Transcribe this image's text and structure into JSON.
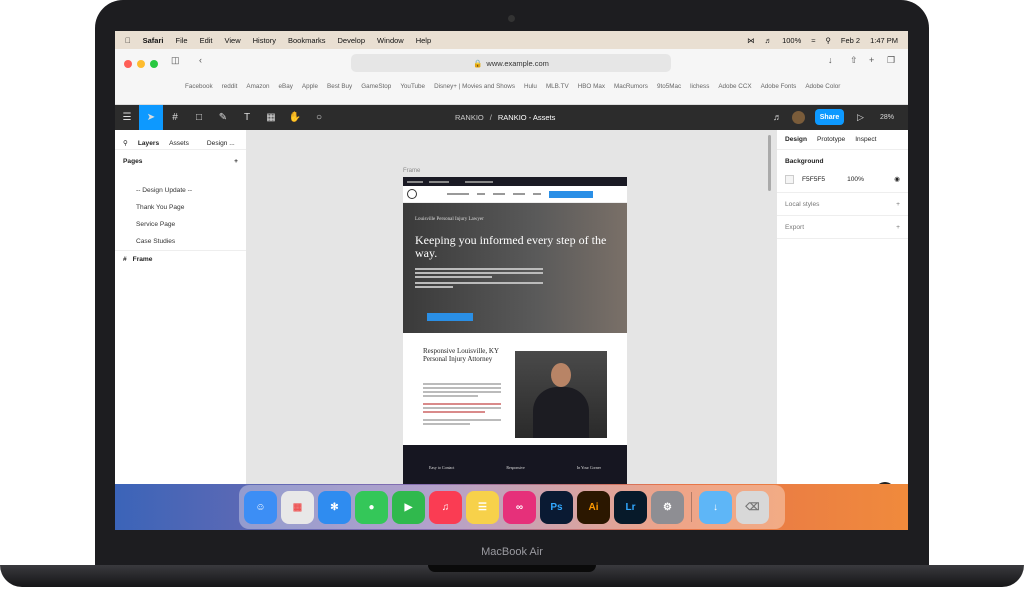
{
  "menubar": {
    "app": "Safari",
    "items": [
      "File",
      "Edit",
      "View",
      "History",
      "Bookmarks",
      "Develop",
      "Window",
      "Help"
    ],
    "battery": "100%",
    "date": "Feb 2",
    "time": "1:47 PM"
  },
  "safari": {
    "url": "www.example.com",
    "favorites": [
      "Facebook",
      "reddit",
      "Amazon",
      "eBay",
      "Apple",
      "Best Buy",
      "GameStop",
      "YouTube",
      "Disney+ | Movies and Shows",
      "Hulu",
      "MLB.TV",
      "HBO Max",
      "MacRumors",
      "9to5Mac",
      "lichess",
      "Adobe CCX",
      "Adobe Fonts",
      "Adobe Color"
    ]
  },
  "figma": {
    "project": "RANKIO",
    "file": "RANKIO - Assets",
    "share": "Share",
    "zoom": "28%"
  },
  "left_panel": {
    "tab_layers": "Layers",
    "tab_assets": "Assets",
    "tab_design": "Design ...",
    "pages_title": "Pages",
    "pages": [
      "-- Design Update --",
      "Thank You Page",
      "Service Page",
      "Case Studies"
    ],
    "layer_frame": "Frame"
  },
  "canvas": {
    "frame_label": "Frame"
  },
  "site": {
    "kicker": "Louisville Personal Injury Lawyer",
    "headline": "Keeping you informed every step of the way.",
    "about_title": "Responsive Louisville, KY Personal Injury Attorney",
    "footer_cols": [
      "Easy to Contact",
      "Responsive",
      "In Your Corner"
    ]
  },
  "right_panel": {
    "tab_design": "Design",
    "tab_prototype": "Prototype",
    "tab_inspect": "Inspect",
    "background_title": "Background",
    "bg_hex": "F5F5F5",
    "bg_opacity": "100%",
    "local_styles": "Local styles",
    "export": "Export",
    "help": "?"
  },
  "laptop": {
    "label": "MacBook Air"
  }
}
